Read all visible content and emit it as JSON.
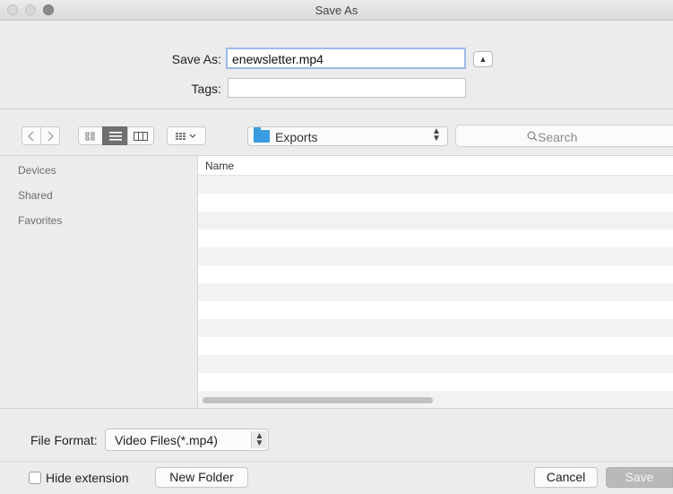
{
  "window": {
    "title": "Save As"
  },
  "form": {
    "save_as_label": "Save As:",
    "filename_value": "enewsletter.mp4",
    "tags_label": "Tags:",
    "tags_value": ""
  },
  "toolbar": {
    "location": "Exports",
    "search_placeholder": "Search"
  },
  "sidebar": {
    "items": [
      {
        "label": "Devices"
      },
      {
        "label": "Shared"
      },
      {
        "label": "Favorites"
      }
    ]
  },
  "file_list": {
    "column_name": "Name",
    "rows": []
  },
  "footer": {
    "file_format_label": "File Format:",
    "file_format_value": "Video Files(*.mp4)",
    "hide_extension_label": "Hide extension",
    "hide_extension_checked": false,
    "new_folder_label": "New Folder",
    "cancel_label": "Cancel",
    "save_label": "Save"
  },
  "colors": {
    "accent_folder": "#3a9be0",
    "focus_ring": "#9bbbe8",
    "disabled_button": "#b9b9b9"
  },
  "icons": [
    "back-icon",
    "forward-icon",
    "icon-view-icon",
    "list-view-icon",
    "column-view-icon",
    "group-view-icon",
    "folder-icon",
    "search-icon",
    "expand-icon",
    "updown-icon"
  ]
}
